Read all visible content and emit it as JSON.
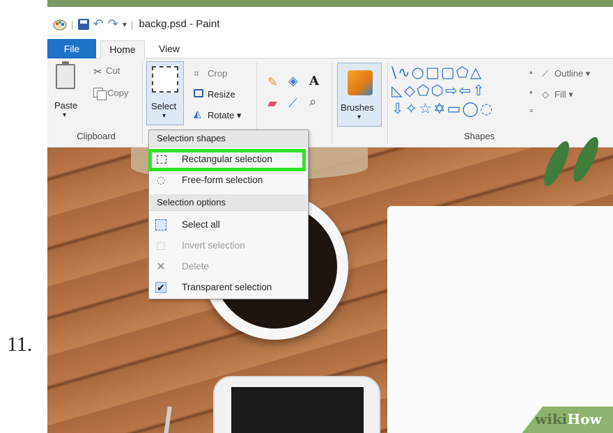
{
  "step_number": "11.",
  "app": {
    "title": "backg.psd - Paint"
  },
  "tabs": [
    {
      "label": "File"
    },
    {
      "label": "Home"
    },
    {
      "label": "View"
    }
  ],
  "ribbon": {
    "clipboard": {
      "paste": "Paste",
      "cut": "Cut",
      "copy": "Copy",
      "group": "Clipboard"
    },
    "image": {
      "select": "Select",
      "crop": "Crop",
      "resize": "Resize",
      "rotate": "Rotate ▾"
    },
    "brushes": "Brushes",
    "shapes": {
      "group": "Shapes",
      "row1": "\\∿○□▢⬠△",
      "row2": "◺◇⬠⬡⇨⇦⇧",
      "row3": "⇩✧☆✡▭◯◌",
      "outline": "Outline ▾",
      "fill": "Fill ▾"
    }
  },
  "menu": {
    "selection_shapes_header": "Selection shapes",
    "rectangular": "Rectangular selection",
    "free_form": "Free-form selection",
    "selection_options_header": "Selection options",
    "select_all": "Select all",
    "invert": "Invert selection",
    "delete": "Delete",
    "transparent": "Transparent selection"
  },
  "watermark": {
    "part1": "wiki",
    "part2": "How"
  },
  "colors": {
    "file_tab": "#1e72c8",
    "highlight": "#2ee51f",
    "shape_blue": "#2a72c8"
  }
}
